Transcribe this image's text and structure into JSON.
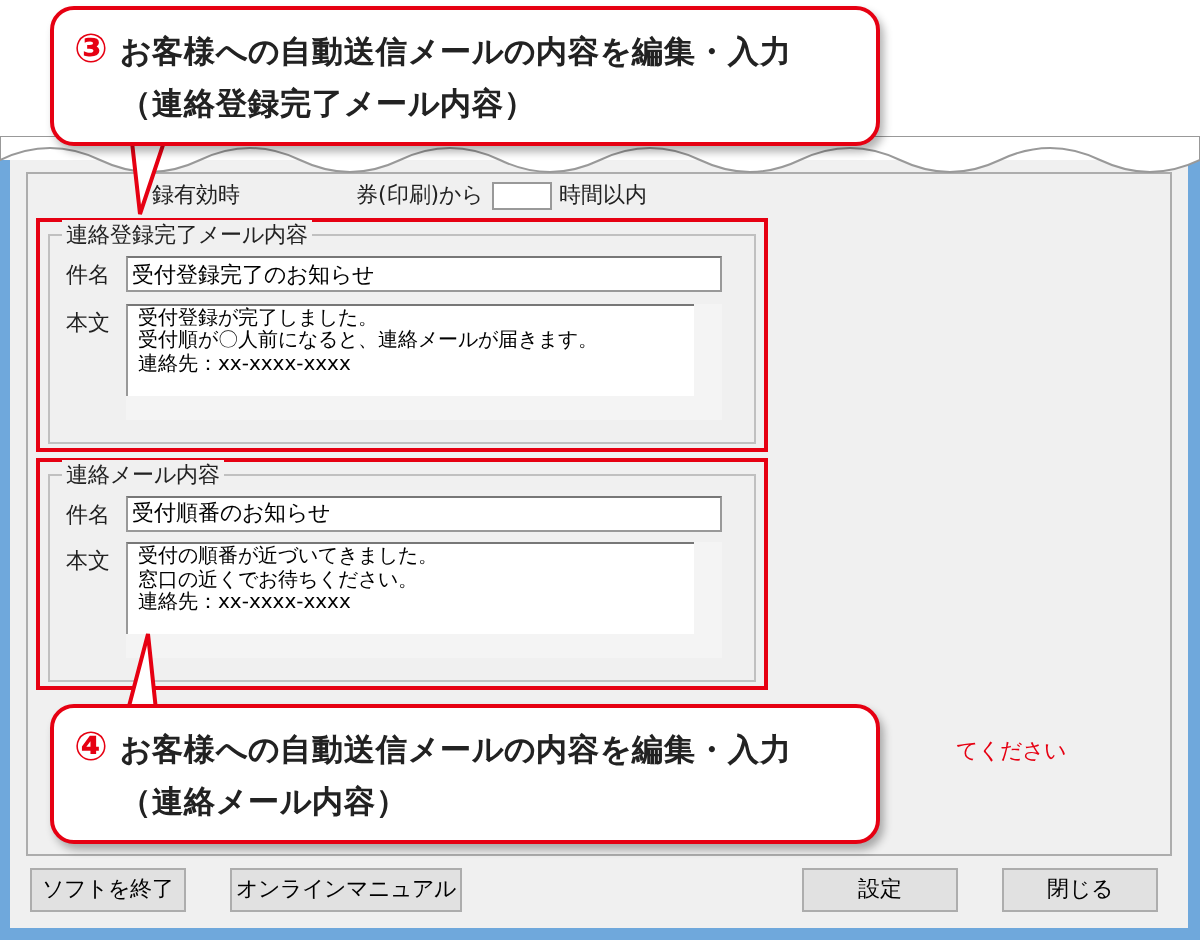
{
  "callouts": [
    {
      "number": "③",
      "lines": [
        "お客様への自動送信メールの内容を編集・入力",
        "（連絡登録完了メール内容）"
      ]
    },
    {
      "number": "④",
      "lines": [
        "お客様への自動送信メールの内容を編集・入力",
        "（連絡メール内容）"
      ]
    }
  ],
  "expiry_row": {
    "texts": [
      "録有効時",
      "券(印刷)から",
      "時間以内"
    ]
  },
  "mail_groups": [
    {
      "title": "連絡登録完了メール内容",
      "highlighted": true,
      "subject_label": "件名",
      "subject": "受付登録完了のお知らせ",
      "body_label": "本文",
      "body_lines": [
        "受付登録が完了しました。",
        "受付順が〇人前になると、連絡メールが届きます。",
        "連絡先：xx-xxxx-xxxx"
      ]
    },
    {
      "title": "連絡メール内容",
      "highlighted": true,
      "subject_label": "件名",
      "subject": "受付順番のお知らせ",
      "body_label": "本文",
      "body_lines": [
        "受付の順番が近づいてきました。",
        "窓口の近くでお待ちください。",
        "連絡先：xx-xxxx-xxxx"
      ]
    }
  ],
  "note": "てください",
  "buttons": [
    "ソフトを終了",
    "オンラインマニュアル",
    "設定",
    "閉じる"
  ]
}
